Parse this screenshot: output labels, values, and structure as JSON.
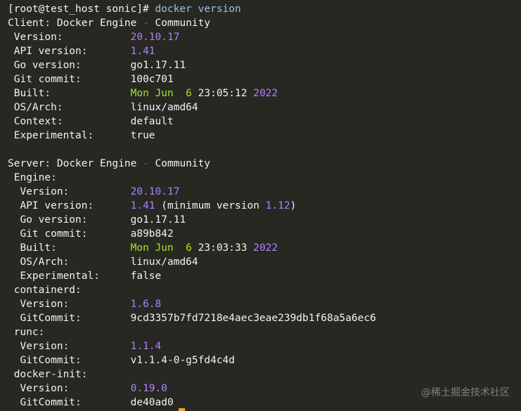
{
  "prompt": {
    "text": "[root@test_host sonic]# ",
    "command": "docker version"
  },
  "lines": [
    [
      {
        "t": "[root@test_host sonic]# ",
        "c": "key"
      },
      {
        "t": "docker version",
        "c": "cmd"
      }
    ],
    [
      {
        "t": "Client",
        "c": "key"
      },
      {
        "t": ": ",
        "c": "punct"
      },
      {
        "t": "Docker Engine ",
        "c": "key"
      },
      {
        "t": "-",
        "c": "pink"
      },
      {
        "t": " Community",
        "c": "key"
      }
    ],
    [
      {
        "t": " Version",
        "c": "key"
      },
      {
        "t": ":           ",
        "c": "punct"
      },
      {
        "t": "20.10.17",
        "c": "purple"
      }
    ],
    [
      {
        "t": " API version",
        "c": "key"
      },
      {
        "t": ":       ",
        "c": "punct"
      },
      {
        "t": "1.41",
        "c": "purple"
      }
    ],
    [
      {
        "t": " Go version",
        "c": "key"
      },
      {
        "t": ":        ",
        "c": "punct"
      },
      {
        "t": "go1.17.11",
        "c": "key"
      }
    ],
    [
      {
        "t": " Git commit",
        "c": "key"
      },
      {
        "t": ":        ",
        "c": "punct"
      },
      {
        "t": "100c701",
        "c": "key"
      }
    ],
    [
      {
        "t": " Built",
        "c": "key"
      },
      {
        "t": ":             ",
        "c": "punct"
      },
      {
        "t": "Mon Jun  6 ",
        "c": "green"
      },
      {
        "t": "23:05:12 ",
        "c": "key"
      },
      {
        "t": "2022",
        "c": "purple"
      }
    ],
    [
      {
        "t": " OS/Arch",
        "c": "key"
      },
      {
        "t": ":           ",
        "c": "punct"
      },
      {
        "t": "linux/amd64",
        "c": "key"
      }
    ],
    [
      {
        "t": " Context",
        "c": "key"
      },
      {
        "t": ":           ",
        "c": "punct"
      },
      {
        "t": "default",
        "c": "key"
      }
    ],
    [
      {
        "t": " Experimental",
        "c": "key"
      },
      {
        "t": ":      ",
        "c": "punct"
      },
      {
        "t": "true",
        "c": "key"
      }
    ],
    [
      {
        "t": "",
        "c": "key"
      }
    ],
    [
      {
        "t": "Server",
        "c": "key"
      },
      {
        "t": ": ",
        "c": "punct"
      },
      {
        "t": "Docker Engine ",
        "c": "key"
      },
      {
        "t": "-",
        "c": "pink"
      },
      {
        "t": " Community",
        "c": "key"
      }
    ],
    [
      {
        "t": " Engine",
        "c": "key"
      },
      {
        "t": ":",
        "c": "punct"
      }
    ],
    [
      {
        "t": "  Version",
        "c": "key"
      },
      {
        "t": ":          ",
        "c": "punct"
      },
      {
        "t": "20.10.17",
        "c": "purple"
      }
    ],
    [
      {
        "t": "  API version",
        "c": "key"
      },
      {
        "t": ":      ",
        "c": "punct"
      },
      {
        "t": "1.41",
        "c": "purple"
      },
      {
        "t": " (minimum version ",
        "c": "key"
      },
      {
        "t": "1.12",
        "c": "purple"
      },
      {
        "t": ")",
        "c": "key"
      }
    ],
    [
      {
        "t": "  Go version",
        "c": "key"
      },
      {
        "t": ":       ",
        "c": "punct"
      },
      {
        "t": "go1.17.11",
        "c": "key"
      }
    ],
    [
      {
        "t": "  Git commit",
        "c": "key"
      },
      {
        "t": ":       ",
        "c": "punct"
      },
      {
        "t": "a89b842",
        "c": "key"
      }
    ],
    [
      {
        "t": "  Built",
        "c": "key"
      },
      {
        "t": ":            ",
        "c": "punct"
      },
      {
        "t": "Mon Jun  6 ",
        "c": "green"
      },
      {
        "t": "23:03:33 ",
        "c": "key"
      },
      {
        "t": "2022",
        "c": "purple"
      }
    ],
    [
      {
        "t": "  OS/Arch",
        "c": "key"
      },
      {
        "t": ":          ",
        "c": "punct"
      },
      {
        "t": "linux/amd64",
        "c": "key"
      }
    ],
    [
      {
        "t": "  Experimental",
        "c": "key"
      },
      {
        "t": ":     ",
        "c": "punct"
      },
      {
        "t": "false",
        "c": "key"
      }
    ],
    [
      {
        "t": " containerd",
        "c": "key"
      },
      {
        "t": ":",
        "c": "punct"
      }
    ],
    [
      {
        "t": "  Version",
        "c": "key"
      },
      {
        "t": ":          ",
        "c": "punct"
      },
      {
        "t": "1.6.8",
        "c": "purple"
      }
    ],
    [
      {
        "t": "  GitCommit",
        "c": "key"
      },
      {
        "t": ":        ",
        "c": "punct"
      },
      {
        "t": "9cd3357b7fd7218e4aec3eae239db1f68a5a6ec6",
        "c": "key"
      }
    ],
    [
      {
        "t": " runc",
        "c": "key"
      },
      {
        "t": ":",
        "c": "punct"
      }
    ],
    [
      {
        "t": "  Version",
        "c": "key"
      },
      {
        "t": ":          ",
        "c": "punct"
      },
      {
        "t": "1.1.4",
        "c": "purple"
      }
    ],
    [
      {
        "t": "  GitCommit",
        "c": "key"
      },
      {
        "t": ":        ",
        "c": "punct"
      },
      {
        "t": "v1.1.4-0-g5fd4c4d",
        "c": "key"
      }
    ],
    [
      {
        "t": " docker-init",
        "c": "key"
      },
      {
        "t": ":",
        "c": "punct"
      }
    ],
    [
      {
        "t": "  Version",
        "c": "key"
      },
      {
        "t": ":          ",
        "c": "punct"
      },
      {
        "t": "0.19.0",
        "c": "purple"
      }
    ],
    [
      {
        "t": "  GitCommit",
        "c": "key"
      },
      {
        "t": ":        ",
        "c": "punct"
      },
      {
        "t": "de40ad0",
        "c": "key"
      }
    ]
  ],
  "watermark": "@稀土掘金技术社区",
  "colors": {
    "background": "#272822",
    "text": "#f2f2f2",
    "number": "#ae81ff",
    "date": "#a6e22e",
    "command": "#9cc3e6",
    "dash": "#f92672",
    "cursor": "#f0a030"
  }
}
